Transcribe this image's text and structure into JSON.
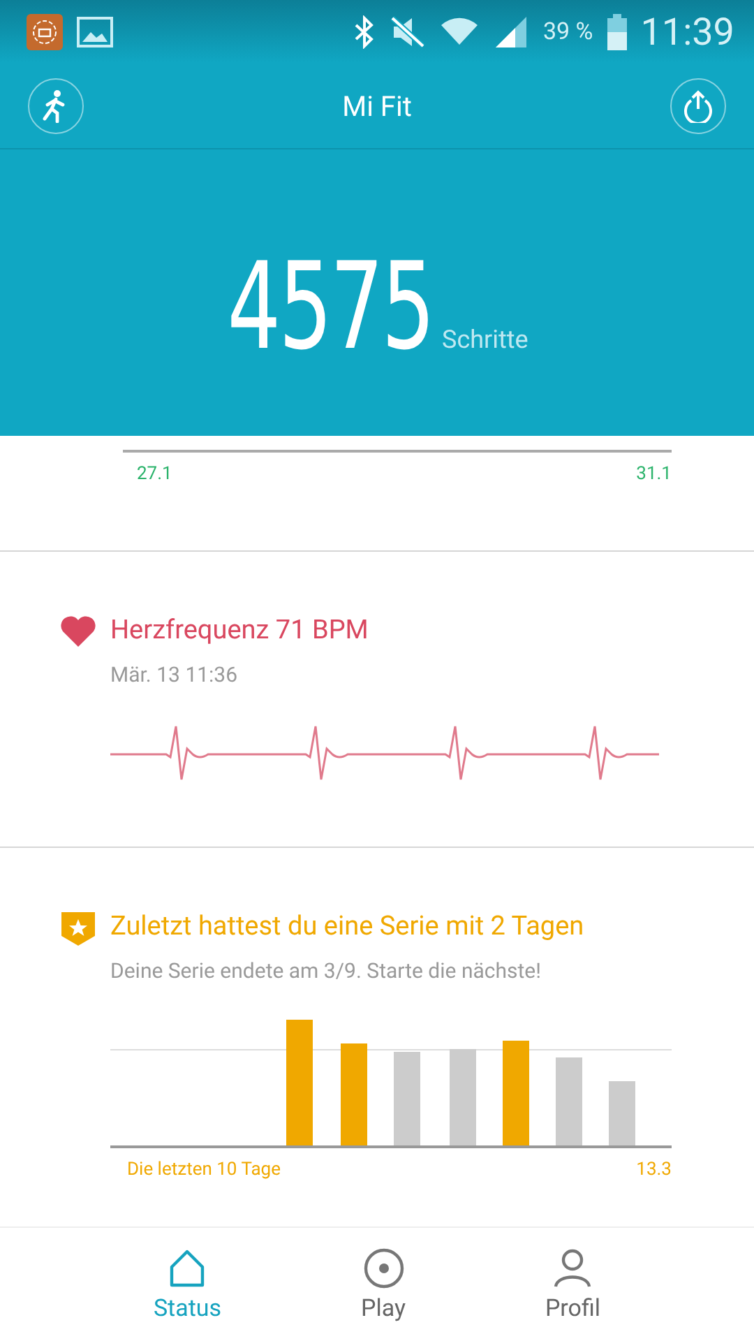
{
  "status_bar": {
    "battery": "39 %",
    "time": "11:39"
  },
  "header": {
    "title": "Mi Fit"
  },
  "steps": {
    "count": "4575",
    "unit": "Schritte",
    "axis_start": "27.1",
    "axis_end": "31.1"
  },
  "heart_rate": {
    "title": "Herzfrequenz 71 BPM",
    "timestamp": "Mär. 13 11:36"
  },
  "streak": {
    "title": "Zuletzt hattest du eine Serie mit 2 Tagen",
    "subtitle": "Deine Serie endete am 3/9. Starte die nächste!",
    "range_label": "Die letzten 10 Tage",
    "end_label": "13.3",
    "bars": [
      {
        "in_streak": true
      },
      {
        "in_streak": true
      },
      {
        "in_streak": false
      },
      {
        "in_streak": false
      },
      {
        "in_streak": true
      },
      {
        "in_streak": false
      },
      {
        "in_streak": false
      }
    ]
  },
  "tabs": [
    {
      "label": "Status",
      "selected": true
    },
    {
      "label": "Play",
      "selected": false
    },
    {
      "label": "Profil",
      "selected": false
    }
  ]
}
